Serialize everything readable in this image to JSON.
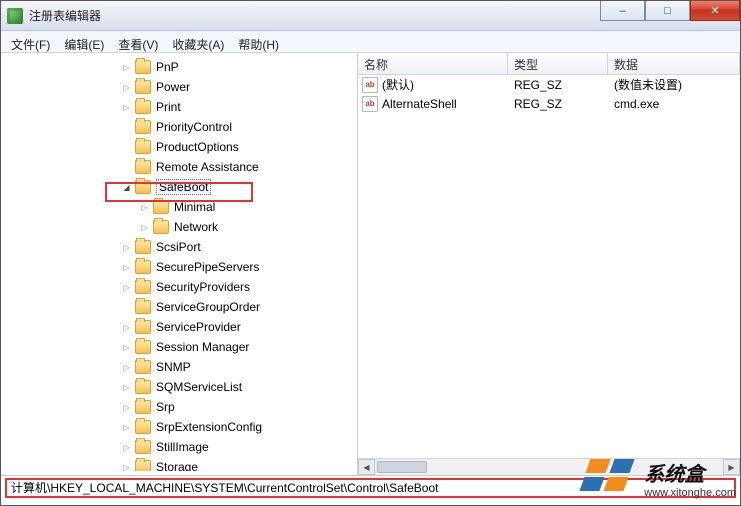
{
  "window": {
    "title": "注册表编辑器"
  },
  "win_buttons": {
    "min": "–",
    "max": "□",
    "close": "✕"
  },
  "menu": {
    "file": "文件(F)",
    "edit": "编辑(E)",
    "view": "查看(V)",
    "fav": "收藏夹(A)",
    "help": "帮助(H)"
  },
  "tree": {
    "items": [
      {
        "indent": 110,
        "arrow": "closed",
        "label": "PnP"
      },
      {
        "indent": 110,
        "arrow": "closed",
        "label": "Power"
      },
      {
        "indent": 110,
        "arrow": "closed",
        "label": "Print"
      },
      {
        "indent": 110,
        "arrow": "none",
        "label": "PriorityControl"
      },
      {
        "indent": 110,
        "arrow": "none",
        "label": "ProductOptions"
      },
      {
        "indent": 110,
        "arrow": "none",
        "label": "Remote Assistance"
      },
      {
        "indent": 110,
        "arrow": "open",
        "label": "SafeBoot",
        "selected": true
      },
      {
        "indent": 128,
        "arrow": "closed",
        "label": "Minimal"
      },
      {
        "indent": 128,
        "arrow": "closed",
        "label": "Network"
      },
      {
        "indent": 110,
        "arrow": "closed",
        "label": "ScsiPort"
      },
      {
        "indent": 110,
        "arrow": "closed",
        "label": "SecurePipeServers"
      },
      {
        "indent": 110,
        "arrow": "closed",
        "label": "SecurityProviders"
      },
      {
        "indent": 110,
        "arrow": "none",
        "label": "ServiceGroupOrder"
      },
      {
        "indent": 110,
        "arrow": "closed",
        "label": "ServiceProvider"
      },
      {
        "indent": 110,
        "arrow": "closed",
        "label": "Session Manager"
      },
      {
        "indent": 110,
        "arrow": "closed",
        "label": "SNMP"
      },
      {
        "indent": 110,
        "arrow": "closed",
        "label": "SQMServiceList"
      },
      {
        "indent": 110,
        "arrow": "closed",
        "label": "Srp"
      },
      {
        "indent": 110,
        "arrow": "closed",
        "label": "SrpExtensionConfig"
      },
      {
        "indent": 110,
        "arrow": "closed",
        "label": "StillImage"
      },
      {
        "indent": 110,
        "arrow": "closed",
        "label": "Storage"
      }
    ]
  },
  "list": {
    "headers": {
      "name": "名称",
      "type": "类型",
      "data": "数据"
    },
    "rows": [
      {
        "name": "(默认)",
        "type": "REG_SZ",
        "data": "(数值未设置)"
      },
      {
        "name": "AlternateShell",
        "type": "REG_SZ",
        "data": "cmd.exe"
      }
    ],
    "icon_label": "ab"
  },
  "status": {
    "path": "计算机\\HKEY_LOCAL_MACHINE\\SYSTEM\\CurrentControlSet\\Control\\SafeBoot"
  },
  "watermark": {
    "title": "系统盒",
    "url": "www.xitonghe.com"
  }
}
